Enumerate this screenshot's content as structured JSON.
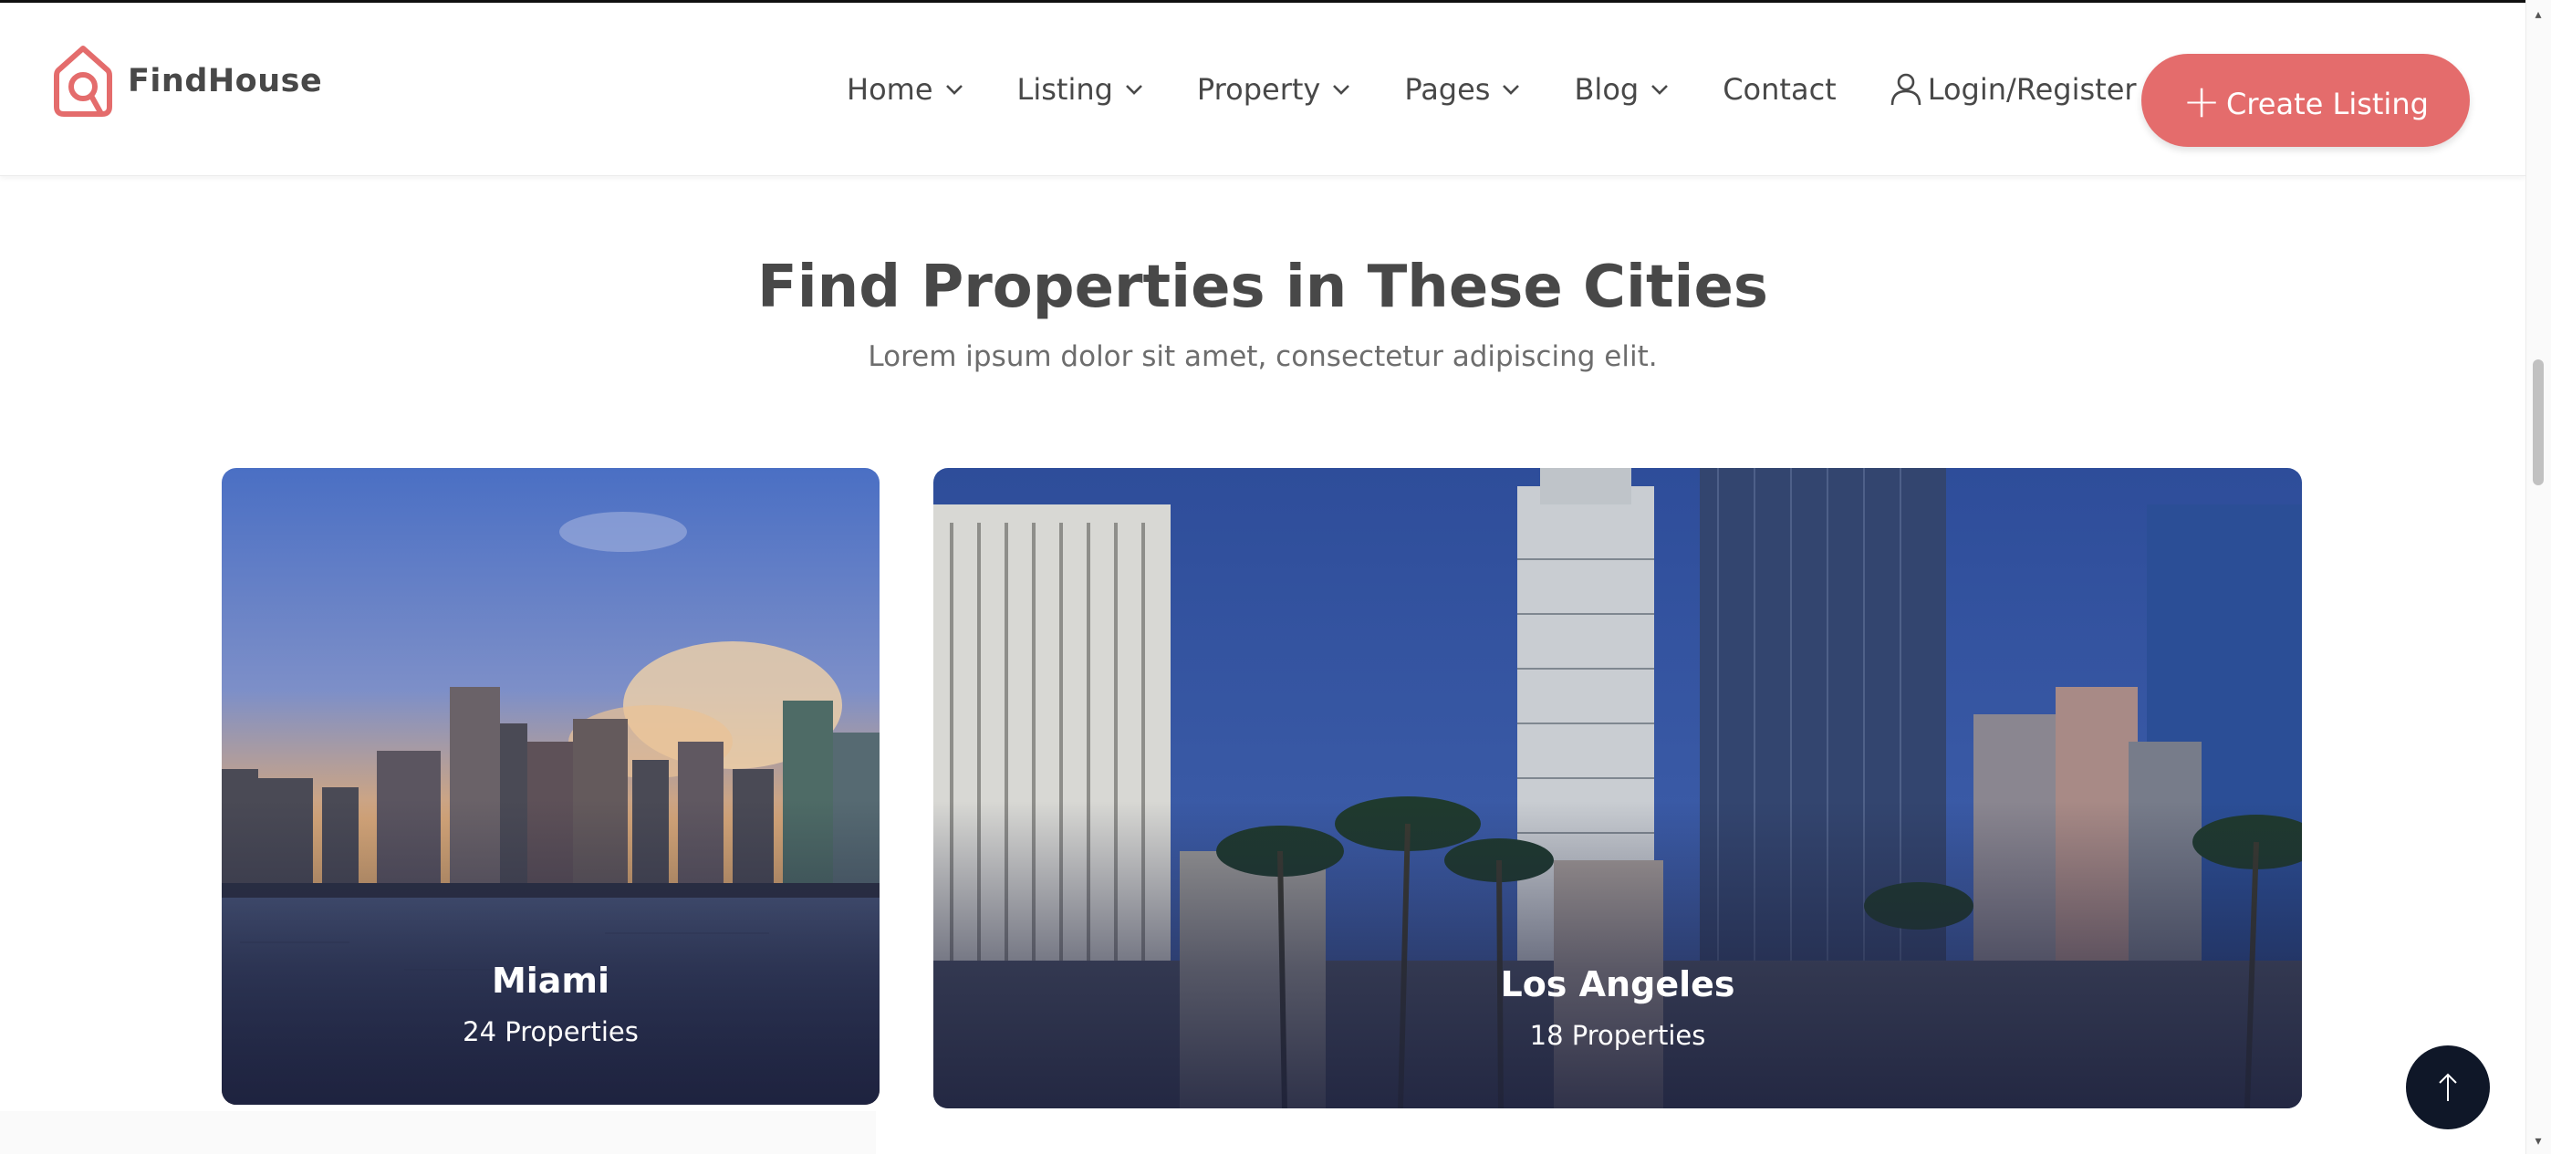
{
  "brand": {
    "name": "FindHouse",
    "accent": "#e46c6c"
  },
  "nav": {
    "items": [
      {
        "label": "Home",
        "has_dropdown": true
      },
      {
        "label": "Listing",
        "has_dropdown": true
      },
      {
        "label": "Property",
        "has_dropdown": true
      },
      {
        "label": "Pages",
        "has_dropdown": true
      },
      {
        "label": "Blog",
        "has_dropdown": true
      },
      {
        "label": "Contact",
        "has_dropdown": false
      }
    ],
    "login_label": "Login/Register",
    "create_label": "Create Listing"
  },
  "section": {
    "title": "Find Properties in These Cities",
    "subtitle": "Lorem ipsum dolor sit amet, consectetur adipiscing elit."
  },
  "cities": [
    {
      "name": "Miami",
      "count": "24 Properties"
    },
    {
      "name": "Los Angeles",
      "count": "18 Properties"
    }
  ],
  "icons": {
    "logo": "house-pin-logo-icon",
    "chevron": "chevron-down-icon",
    "user": "user-icon",
    "plus": "plus-icon",
    "back_to_top": "arrow-up-icon"
  }
}
